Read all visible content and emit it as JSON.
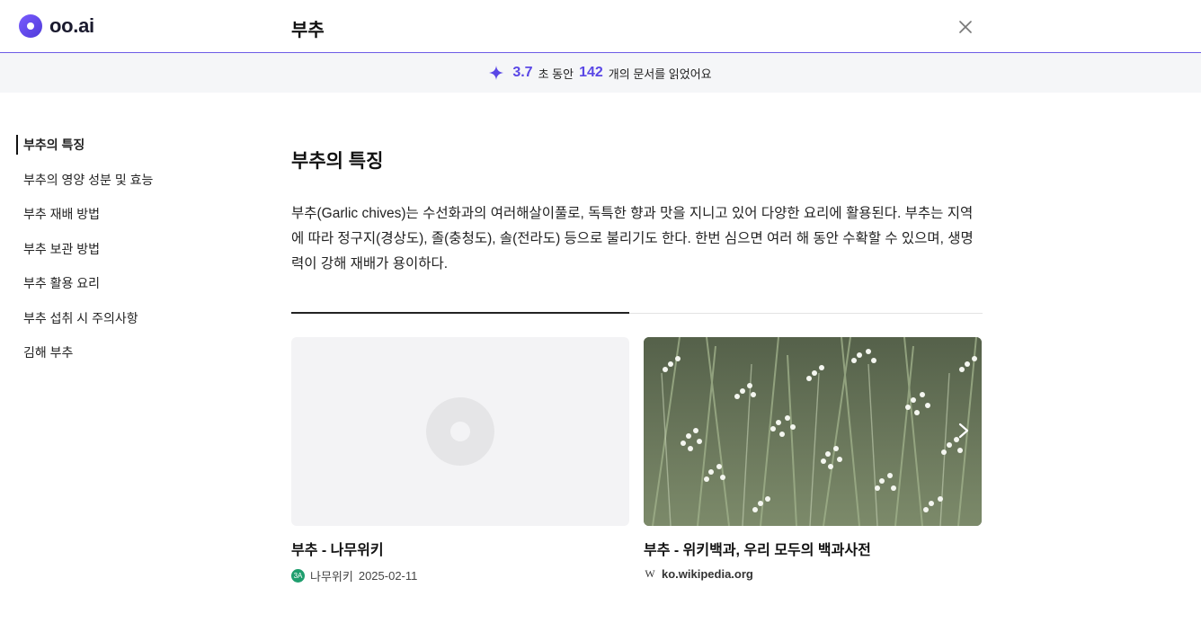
{
  "app": {
    "logo_text": "oo.ai"
  },
  "header": {
    "query": "부추"
  },
  "status": {
    "seconds": "3.7",
    "seconds_suffix": "초 동안",
    "docs": "142",
    "docs_suffix": "개의 문서를 읽었어요"
  },
  "toc": {
    "items": [
      {
        "label": "부추의 특징",
        "active": true
      },
      {
        "label": "부추의 영양 성분 및 효능"
      },
      {
        "label": "부추 재배 방법"
      },
      {
        "label": "부추 보관 방법"
      },
      {
        "label": "부추 활용 요리"
      },
      {
        "label": "부추 섭취 시 주의사항"
      },
      {
        "label": "김해 부추"
      }
    ]
  },
  "section": {
    "title": "부추의 특징",
    "paragraph": "부추(Garlic chives)는 수선화과의 여러해살이풀로, 독특한 향과 맛을 지니고 있어 다양한 요리에 활용된다. 부추는 지역에 따라 정구지(경상도), 졸(충청도), 솔(전라도) 등으로 불리기도 한다. 한번 심으면 여러 해 동안 수확할 수 있으며, 생명력이 강해 재배가 용이하다."
  },
  "sources": [
    {
      "title": "부추 - 나무위키",
      "site": "나무위키",
      "date": "2025-02-11",
      "favicon_text": "3A"
    },
    {
      "title": "부추 - 위키백과, 우리 모두의 백과사전",
      "site": "ko.wikipedia.org",
      "favicon_text": "W"
    }
  ],
  "colors": {
    "accent": "#5a47e6",
    "header_border": "#6d5ce6",
    "status_bg": "#f5f6f8"
  },
  "icons": {
    "close": "close-icon",
    "spark": "sparkle-icon",
    "next": "chevron-right-icon"
  }
}
